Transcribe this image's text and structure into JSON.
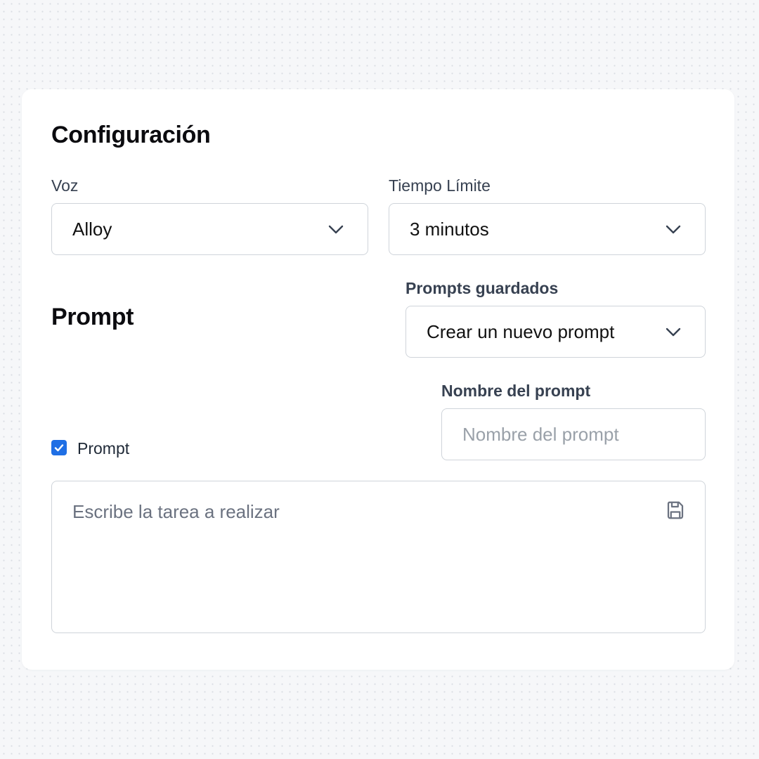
{
  "config": {
    "title": "Configuración",
    "voice": {
      "label": "Voz",
      "value": "Alloy"
    },
    "time_limit": {
      "label": "Tiempo Límite",
      "value": "3 minutos"
    }
  },
  "prompt": {
    "title": "Prompt",
    "saved_prompts": {
      "label": "Prompts guardados",
      "value": "Crear un nuevo prompt"
    },
    "prompt_name": {
      "label": "Nombre del prompt",
      "placeholder": "Nombre del prompt",
      "value": ""
    },
    "checkbox": {
      "label": "Prompt",
      "checked": true
    },
    "task": {
      "placeholder": "Escribe la tarea a realizar",
      "value": ""
    }
  },
  "icons": {
    "chevron": "chevron-down-icon",
    "save": "save-icon",
    "check": "checkmark-icon"
  },
  "colors": {
    "accent": "#1f6fe5",
    "border": "#cfd4da",
    "placeholder": "#9aa1a9"
  }
}
